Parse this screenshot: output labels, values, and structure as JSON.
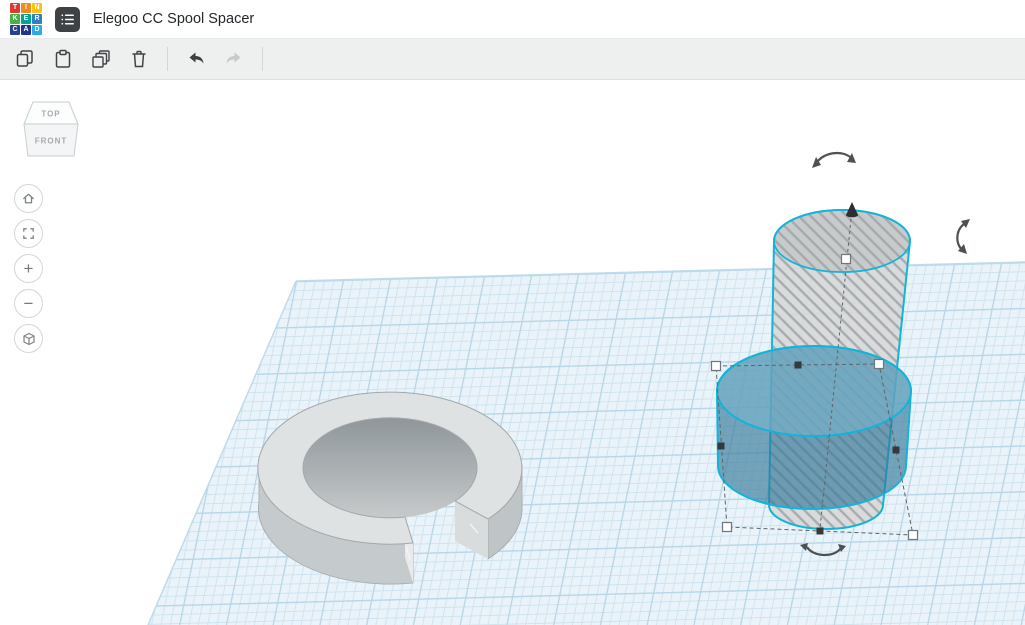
{
  "header": {
    "title": "Elegoo CC Spool Spacer",
    "logo": {
      "tiles": [
        {
          "letter": "T",
          "color": "#d93a31"
        },
        {
          "letter": "I",
          "color": "#f08b1d"
        },
        {
          "letter": "N",
          "color": "#f9c313"
        },
        {
          "letter": "K",
          "color": "#48b04b"
        },
        {
          "letter": "E",
          "color": "#00a49b"
        },
        {
          "letter": "R",
          "color": "#2f7fc1"
        },
        {
          "letter": "C",
          "color": "#2b3f90"
        },
        {
          "letter": "A",
          "color": "#25348b"
        },
        {
          "letter": "D",
          "color": "#28ace2"
        }
      ]
    }
  },
  "toolbar": {
    "buttons": [
      "copy",
      "paste",
      "duplicate",
      "delete",
      "undo",
      "redo"
    ],
    "redo_disabled": true
  },
  "viewcube": {
    "top_label": "TOP",
    "front_label": "FRONT"
  },
  "nav": {
    "zoom_in_label": "+",
    "zoom_out_label": "−"
  },
  "canvas": {
    "background": "#ffffff",
    "workplane": {
      "fill": "#e9f3f9",
      "grid_minor": "#cfe4ef",
      "grid_major": "#b7d6e7",
      "edge": "#bedbe9"
    },
    "selection": {
      "outline": "#14b4da",
      "handle_fill": "#ffffff",
      "handle_stroke": "#70767a",
      "handle_dark": "#35393c",
      "dash": "#5f6468",
      "rotate_arrow": "#4c5154"
    },
    "objects": {
      "spacer_ring": {
        "top": "#dfe2e3",
        "side_front": "#c5cacc",
        "side_right": "#bfc4c6",
        "end_face": "#e8eaeb",
        "end_face_right": "#d9dcdd",
        "inner_top": "#8f969a",
        "inner_bottom": "#c6cacb",
        "outline": "#a2a8ab"
      },
      "hole_cylinder": {
        "fill": "#d7d8d9",
        "top_fill": "#c8cbcc",
        "stripe": "#9fa3a5"
      },
      "solid_cylinder": {
        "side": "#35799b",
        "top": "#7ab4cc"
      }
    }
  }
}
